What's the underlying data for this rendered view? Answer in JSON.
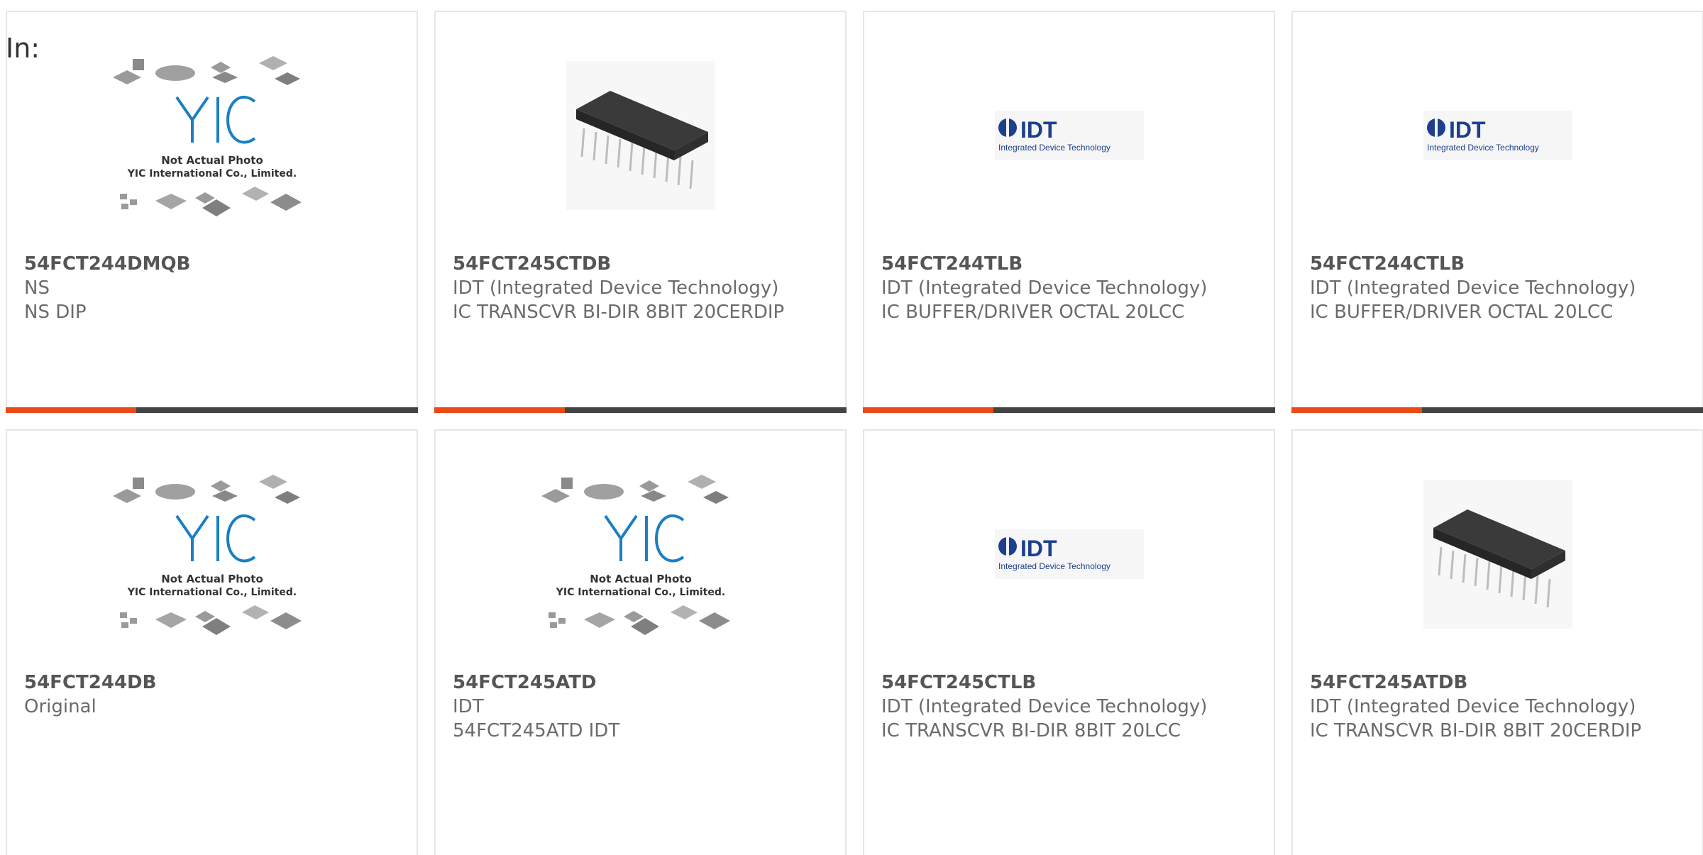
{
  "page": {
    "in_label": "In:"
  },
  "cards": [
    {
      "part": "54FCT244DMQB",
      "manufacturer": "NS",
      "description": "NS DIP",
      "image": "yic-placeholder",
      "caption1": "Not Actual Photo",
      "caption2": "YIC International Co., Limited."
    },
    {
      "part": "54FCT245CTDB",
      "manufacturer": "IDT (Integrated Device Technology)",
      "description": "IC TRANSCVR BI-DIR 8BIT 20CERDIP",
      "image": "dip-chip"
    },
    {
      "part": "54FCT244TLB",
      "manufacturer": "IDT (Integrated Device Technology)",
      "description": "IC BUFFER/DRIVER OCTAL 20LCC",
      "image": "idt-logo",
      "logo_text": "IDT",
      "logo_sub": "Integrated Device Technology"
    },
    {
      "part": "54FCT244CTLB",
      "manufacturer": "IDT (Integrated Device Technology)",
      "description": "IC BUFFER/DRIVER OCTAL 20LCC",
      "image": "idt-logo",
      "logo_text": "IDT",
      "logo_sub": "Integrated Device Technology"
    },
    {
      "part": "54FCT244DB",
      "manufacturer": "Original",
      "description": "",
      "image": "yic-placeholder",
      "caption1": "Not Actual Photo",
      "caption2": "YIC International Co., Limited."
    },
    {
      "part": "54FCT245ATD",
      "manufacturer": "IDT",
      "description": "54FCT245ATD IDT",
      "image": "yic-placeholder",
      "caption1": "Not Actual Photo",
      "caption2": "YIC International Co., Limited."
    },
    {
      "part": "54FCT245CTLB",
      "manufacturer": "IDT (Integrated Device Technology)",
      "description": "IC TRANSCVR BI-DIR 8BIT 20LCC",
      "image": "idt-logo",
      "logo_text": "IDT",
      "logo_sub": "Integrated Device Technology"
    },
    {
      "part": "54FCT245ATDB",
      "manufacturer": "IDT (Integrated Device Technology)",
      "description": "IC TRANSCVR BI-DIR 8BIT 20CERDIP",
      "image": "dip-chip"
    }
  ],
  "colors": {
    "accent_bar": "#ea4a17",
    "dark_bar": "#444444",
    "idt_blue": "#1d3f8e",
    "yic_blue": "#1a7fc3"
  }
}
